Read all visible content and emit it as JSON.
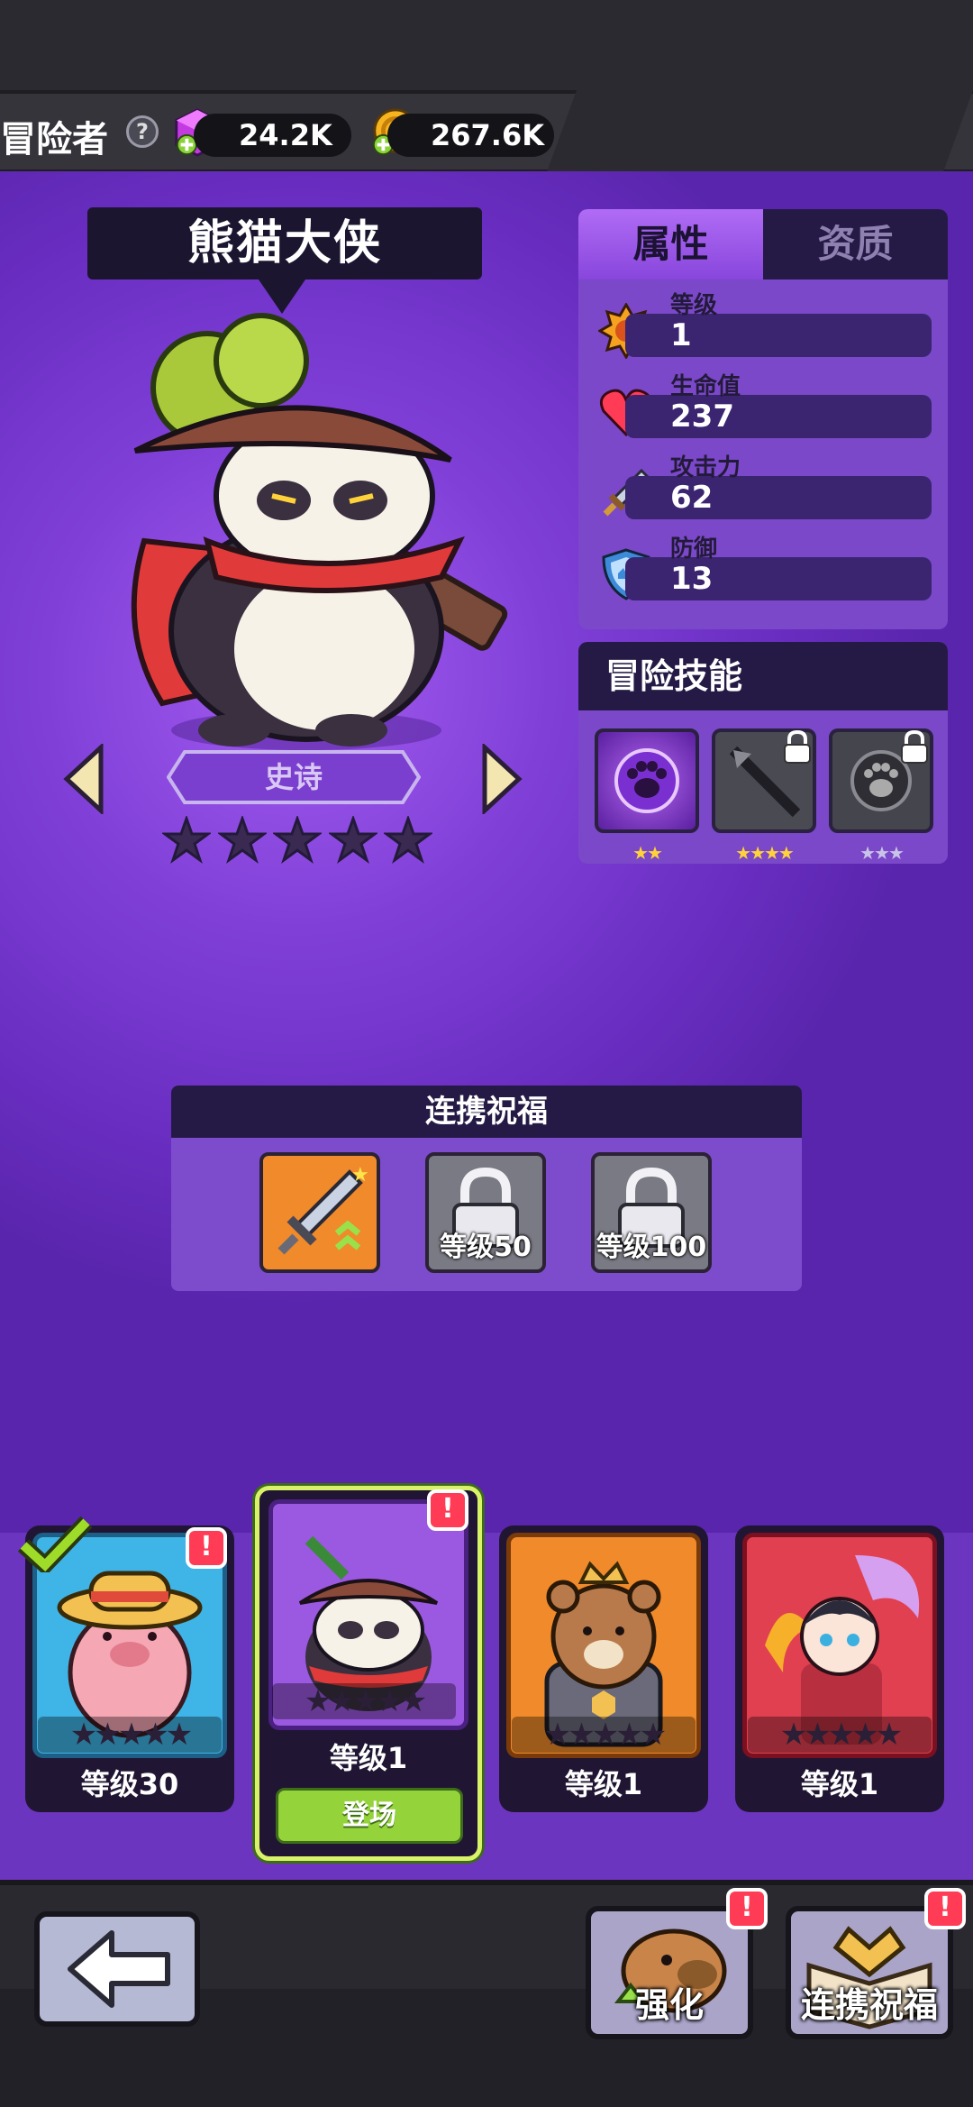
{
  "header": {
    "title": "冒险者",
    "gems": "24.2K",
    "coins": "267.6K"
  },
  "hero": {
    "name": "熊猫大侠",
    "rarity": "史诗",
    "stars_filled": 0,
    "stars_total": 5
  },
  "attributes": {
    "tabs": [
      "属性",
      "资质"
    ],
    "active_tab": "属性",
    "stats": [
      {
        "label": "等级",
        "value": "1",
        "icon": "sun-badge-icon"
      },
      {
        "label": "生命值",
        "value": "237",
        "icon": "heart-icon"
      },
      {
        "label": "攻击力",
        "value": "62",
        "icon": "sword-icon"
      },
      {
        "label": "防御",
        "value": "13",
        "icon": "shield-icon"
      }
    ]
  },
  "skills": {
    "title": "冒险技能",
    "items": [
      {
        "stars": 2,
        "locked": false,
        "icon": "paw-icon"
      },
      {
        "stars": 4,
        "locked": true,
        "icon": "spear-icon"
      },
      {
        "stars": 3,
        "locked": true,
        "icon": "paw-icon"
      }
    ]
  },
  "blessing": {
    "title": "连携祝福",
    "items": [
      {
        "label": "",
        "locked": false,
        "icon": "sword-upgrade-icon"
      },
      {
        "label": "等级50",
        "locked": true,
        "icon": "lock-icon"
      },
      {
        "label": "等级100",
        "locked": true,
        "icon": "lock-icon"
      }
    ]
  },
  "roster": [
    {
      "level": "等级30",
      "frame": "#3fb4e6",
      "owned": true,
      "alert": true
    },
    {
      "level": "等级1",
      "frame": "#9b58e0",
      "selected": true,
      "alert": true,
      "action": "登场"
    },
    {
      "level": "等级1",
      "frame": "#f08a2a"
    },
    {
      "level": "等级1",
      "frame": "#e04050"
    }
  ],
  "bottom": {
    "enhance": "强化",
    "blessing": "连携祝福"
  },
  "colors": {
    "accent_purple": "#8a45dc",
    "panel_dark": "#251a45",
    "alert_red": "#ff3b55",
    "deploy_green": "#95d33a"
  }
}
